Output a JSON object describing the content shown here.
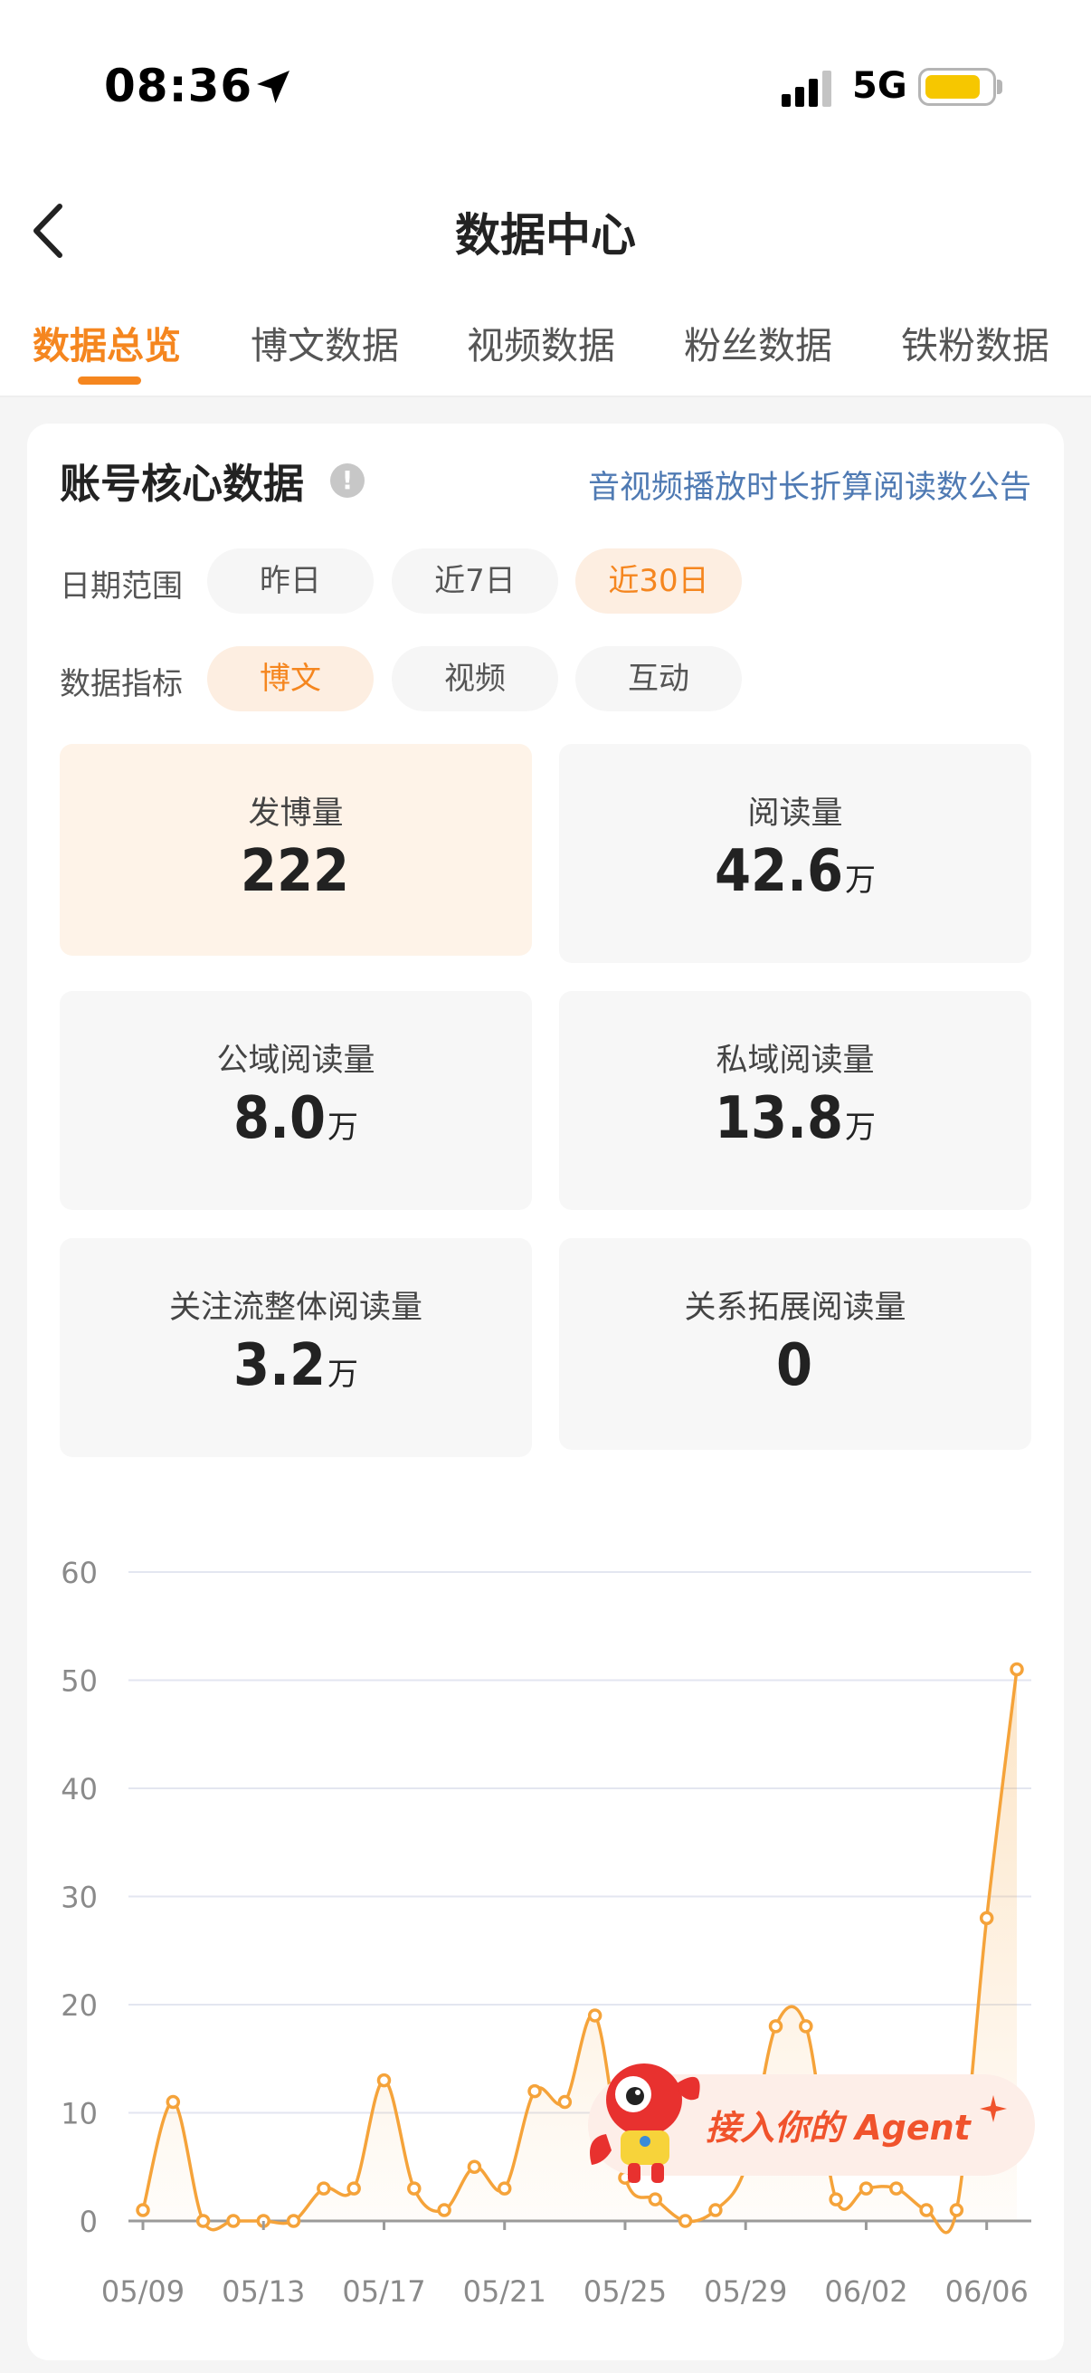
{
  "status_bar": {
    "time": "08:36",
    "network": "5G"
  },
  "nav": {
    "title": "数据中心"
  },
  "tabs": [
    {
      "label": "数据总览",
      "active": true
    },
    {
      "label": "博文数据",
      "active": false
    },
    {
      "label": "视频数据",
      "active": false
    },
    {
      "label": "粉丝数据",
      "active": false
    },
    {
      "label": "铁粉数据",
      "active": false
    }
  ],
  "card": {
    "title": "账号核心数据",
    "notice_link": "音视频播放时长折算阅读数公告",
    "date_range": {
      "label": "日期范围",
      "options": [
        "昨日",
        "近7日",
        "近30日"
      ],
      "selected": "近30日"
    },
    "metric_type": {
      "label": "数据指标",
      "options": [
        "博文",
        "视频",
        "互动"
      ],
      "selected": "博文"
    },
    "metrics": [
      {
        "label": "发博量",
        "value": "222",
        "unit": ""
      },
      {
        "label": "阅读量",
        "value": "42.6",
        "unit": "万"
      },
      {
        "label": "公域阅读量",
        "value": "8.0",
        "unit": "万"
      },
      {
        "label": "私域阅读量",
        "value": "13.8",
        "unit": "万"
      },
      {
        "label": "关注流整体阅读量",
        "value": "3.2",
        "unit": "万"
      },
      {
        "label": "关系拓展阅读量",
        "value": "0",
        "unit": ""
      }
    ]
  },
  "chart_data": {
    "type": "line",
    "x": [
      "05/09",
      "05/10",
      "05/11",
      "05/12",
      "05/13",
      "05/14",
      "05/15",
      "05/16",
      "05/17",
      "05/18",
      "05/19",
      "05/20",
      "05/21",
      "05/22",
      "05/23",
      "05/24",
      "05/25",
      "05/26",
      "05/27",
      "05/28",
      "05/29",
      "05/30",
      "05/31",
      "06/01",
      "06/02",
      "06/03",
      "06/04",
      "06/05",
      "06/06",
      "06/07"
    ],
    "values": [
      1,
      11,
      0,
      0,
      0,
      0,
      3,
      3,
      13,
      3,
      1,
      5,
      3,
      12,
      11,
      19,
      4,
      2,
      0,
      1,
      5,
      18,
      18,
      2,
      3,
      3,
      1,
      1,
      28,
      51
    ],
    "x_tick_labels": [
      "05/09",
      "05/13",
      "05/17",
      "05/21",
      "05/25",
      "05/29",
      "06/02",
      "06/06"
    ],
    "y_ticks": [
      0,
      10,
      20,
      30,
      40,
      50,
      60
    ],
    "ylim": [
      0,
      60
    ],
    "grid": true,
    "line_color": "#f5a33a"
  },
  "agent_banner": {
    "text": "接入你的 Agent"
  },
  "icons": {
    "back": "chevron-left-icon",
    "location": "location-arrow-icon",
    "signal": "signal-bars-icon",
    "battery": "battery-icon",
    "info": "info-icon",
    "sparkle": "sparkle-icon",
    "mascot": "mascot-icon"
  }
}
